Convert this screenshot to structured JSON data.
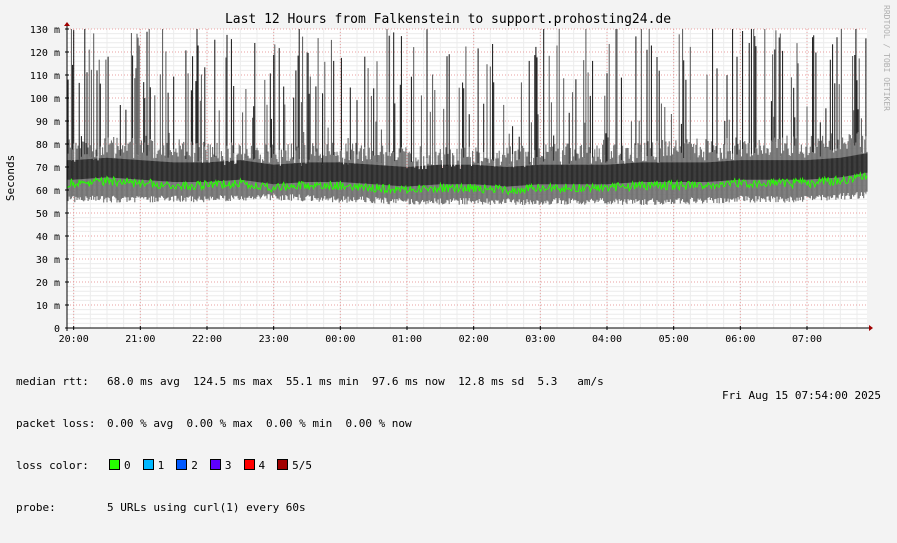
{
  "watermark": "RRDTOOL / TOBI OETIKER",
  "stats": {
    "median_rtt": {
      "label": "median rtt:",
      "avg": "68.0 ms avg",
      "max": "124.5 ms max",
      "min": "55.1 ms min",
      "now": "97.6 ms now",
      "sd": "12.8 ms sd",
      "am": "5.3",
      "am_unit": "am/s"
    },
    "packet_loss": {
      "label": "packet loss:",
      "avg": "0.00 % avg",
      "max": "0.00 % max",
      "min": "0.00 % min",
      "now": "0.00 % now"
    },
    "loss_color": {
      "label": "loss color:",
      "items": [
        {
          "label": "0",
          "color": "#26ff00"
        },
        {
          "label": "1",
          "color": "#00b8ff"
        },
        {
          "label": "2",
          "color": "#0059ff"
        },
        {
          "label": "3",
          "color": "#5e00ff"
        },
        {
          "label": "4",
          "color": "#ff0000"
        },
        {
          "label": "5/5",
          "color": "#a10000"
        }
      ]
    },
    "probe": {
      "label": "probe:",
      "value": "5 URLs using curl(1) every 60s"
    }
  },
  "timestamp": "Fri Aug 15 07:54:00 2025",
  "chart_data": {
    "type": "line",
    "title": "Last 12 Hours from Falkenstein to support.prohosting24.de",
    "ylabel": "Seconds",
    "xlabel": "",
    "ylim": [
      0,
      130
    ],
    "xlim": [
      "19:54",
      "07:54"
    ],
    "yticks": [
      {
        "value": 0,
        "label": "0"
      },
      {
        "value": 10,
        "label": "10 m"
      },
      {
        "value": 20,
        "label": "20 m"
      },
      {
        "value": 30,
        "label": "30 m"
      },
      {
        "value": 40,
        "label": "40 m"
      },
      {
        "value": 50,
        "label": "50 m"
      },
      {
        "value": 60,
        "label": "60 m"
      },
      {
        "value": 70,
        "label": "70 m"
      },
      {
        "value": 80,
        "label": "80 m"
      },
      {
        "value": 90,
        "label": "90 m"
      },
      {
        "value": 100,
        "label": "100 m"
      },
      {
        "value": 110,
        "label": "110 m"
      },
      {
        "value": 120,
        "label": "120 m"
      },
      {
        "value": 130,
        "label": "130 m"
      }
    ],
    "xticks": [
      "20:00",
      "21:00",
      "22:00",
      "23:00",
      "00:00",
      "01:00",
      "02:00",
      "03:00",
      "04:00",
      "05:00",
      "06:00",
      "07:00"
    ],
    "grid": true,
    "series": [
      {
        "name": "median rtt",
        "color": "#26ff00",
        "x": [
          "20:00",
          "20:30",
          "21:00",
          "21:30",
          "22:00",
          "22:30",
          "23:00",
          "23:30",
          "00:00",
          "00:30",
          "01:00",
          "01:30",
          "02:00",
          "02:30",
          "03:00",
          "03:30",
          "04:00",
          "04:30",
          "05:00",
          "05:30",
          "06:00",
          "06:30",
          "07:00",
          "07:30",
          "07:54"
        ],
        "values": [
          63,
          64,
          63,
          62,
          62,
          63,
          61,
          62,
          62,
          61,
          60,
          61,
          61,
          60,
          61,
          61,
          61,
          62,
          62,
          62,
          63,
          63,
          63,
          64,
          66
        ]
      },
      {
        "name": "rtt spread (smoke)",
        "color": "#000000",
        "x": [
          "20:00",
          "21:00",
          "22:00",
          "23:00",
          "00:00",
          "01:00",
          "02:00",
          "03:00",
          "04:00",
          "05:00",
          "06:00",
          "07:00",
          "07:54"
        ],
        "low": [
          56,
          56,
          56,
          57,
          56,
          55,
          55,
          55,
          55,
          55,
          56,
          56,
          58
        ],
        "high": [
          78,
          80,
          77,
          76,
          77,
          75,
          75,
          76,
          77,
          78,
          79,
          80,
          82
        ],
        "peak": [
          130,
          130,
          125,
          120,
          130,
          125,
          120,
          125,
          130,
          130,
          130,
          130,
          130
        ]
      }
    ]
  }
}
